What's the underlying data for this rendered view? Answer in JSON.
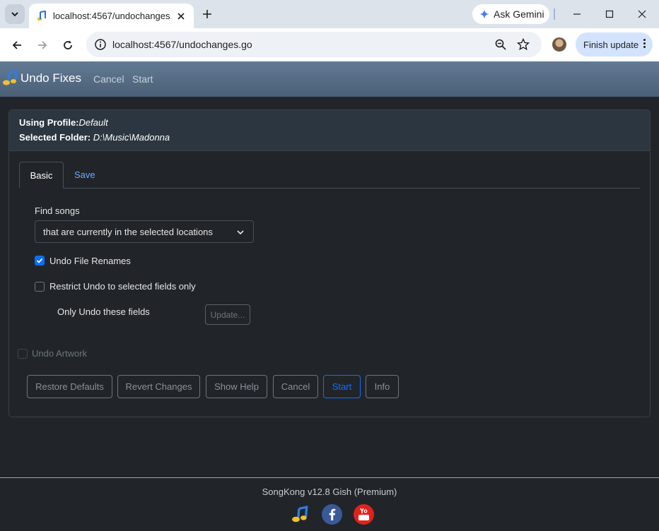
{
  "browser": {
    "tab_title": "localhost:4567/undochanges.go",
    "url": "localhost:4567/undochanges.go",
    "ask_gemini": "Ask Gemini",
    "finish_update": "Finish update"
  },
  "navbar": {
    "title": "Undo Fixes",
    "links": [
      "Cancel",
      "Start"
    ]
  },
  "header": {
    "profile_label": "Using Profile:",
    "profile_value": "Default",
    "folder_label": "Selected Folder:",
    "folder_value": "D:\\Music\\Madonna"
  },
  "tabs": [
    "Basic",
    "Save"
  ],
  "form": {
    "find_songs_label": "Find songs",
    "find_songs_value": "that are currently in the selected locations",
    "undo_renames_label": "Undo File Renames",
    "undo_renames_checked": true,
    "restrict_label": "Restrict Undo to selected fields only",
    "restrict_checked": false,
    "only_fields_label": "Only Undo these fields",
    "update_button": "Update...",
    "undo_artwork_label": "Undo Artwork",
    "undo_artwork_checked": false
  },
  "buttons": [
    "Restore Defaults",
    "Revert Changes",
    "Show Help",
    "Cancel",
    "Start",
    "Info"
  ],
  "footer": {
    "text": "SongKong v12.8 Gish (Premium)"
  },
  "colors": {
    "accent": "#0d6efd",
    "navbar": "#566c84",
    "background": "#212529",
    "facebook": "#3b5998",
    "youtube": "#e0221b"
  }
}
